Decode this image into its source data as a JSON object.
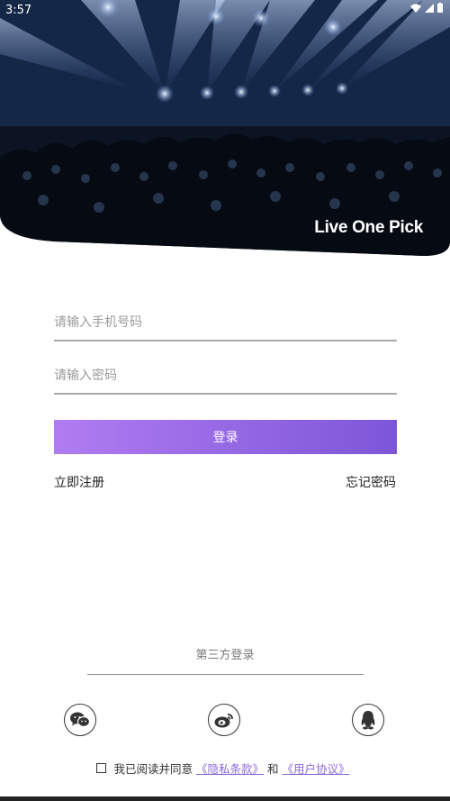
{
  "status_bar": {
    "time": "3:57"
  },
  "brand": "Live One Pick",
  "form": {
    "phone_placeholder": "请输入手机号码",
    "password_placeholder": "请输入密码",
    "login_label": "登录",
    "register_label": "立即注册",
    "forgot_label": "忘记密码"
  },
  "third_party": {
    "title": "第三方登录",
    "providers": [
      "wechat-icon",
      "weibo-icon",
      "qq-icon"
    ]
  },
  "agreement": {
    "prefix": "我已阅读并同意",
    "privacy": "《隐私条款》",
    "and": "和",
    "terms": "《用户协议》"
  },
  "colors": {
    "button_start": "#b07cf1",
    "button_end": "#7d56d8",
    "link": "#8a6ad6"
  }
}
